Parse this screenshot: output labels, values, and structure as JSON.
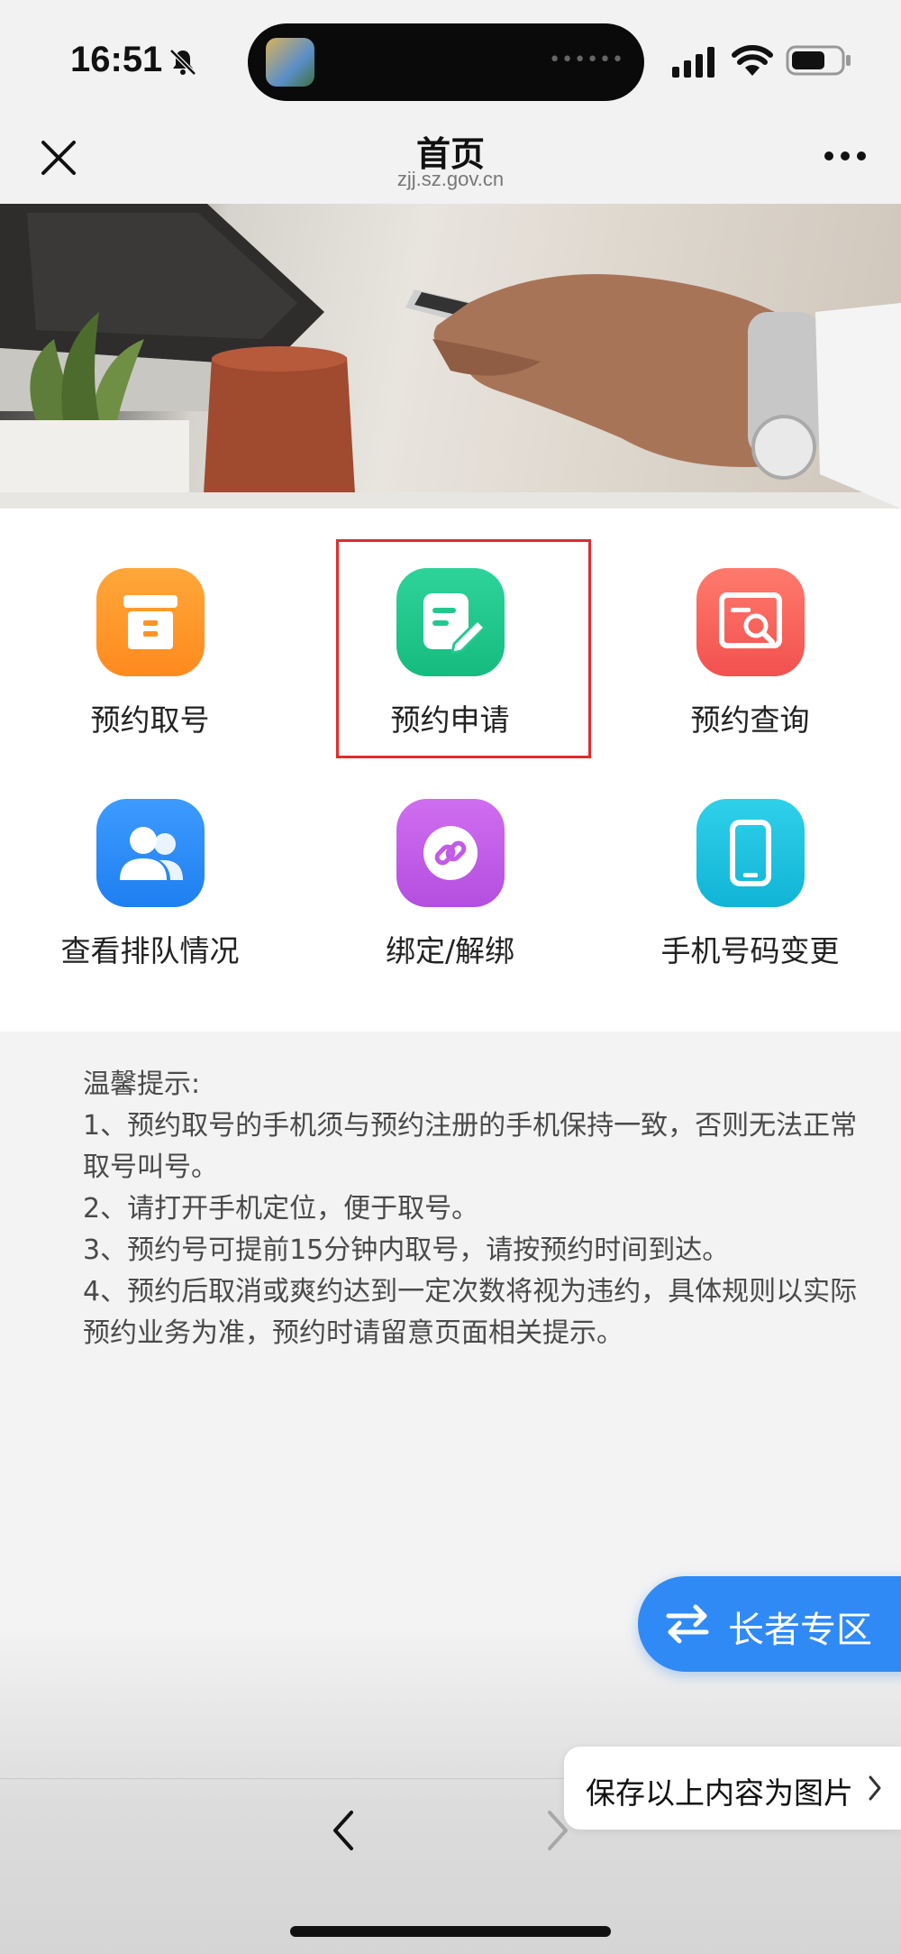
{
  "status_bar": {
    "time": "16:51",
    "icons": [
      "bell-off-icon",
      "signal-icon",
      "wifi-icon",
      "battery-icon"
    ]
  },
  "nav": {
    "title": "首页",
    "subtitle": "zjj.sz.gov.cn",
    "close_icon": "close-icon",
    "more_icon": "more-icon"
  },
  "grid": {
    "items": [
      {
        "label": "预约取号",
        "icon": "archive-icon",
        "color": "#ff9327"
      },
      {
        "label": "预约申请",
        "icon": "edit-document-icon",
        "color": "#22c98f"
      },
      {
        "label": "预约查询",
        "icon": "search-document-icon",
        "color": "#f7645e"
      },
      {
        "label": "查看排队情况",
        "icon": "users-icon",
        "color": "#2f8cf5"
      },
      {
        "label": "绑定/解绑",
        "icon": "link-icon",
        "color": "#c35ae8"
      },
      {
        "label": "手机号码变更",
        "icon": "phone-icon",
        "color": "#1dc2df"
      }
    ],
    "highlighted_item": "预约申请",
    "highlight_color": "#e02b2b"
  },
  "tips": {
    "title": "温馨提示:",
    "lines": [
      "1、预约取号的手机须与预约注册的手机保持一致，否则无法正常取号叫号。",
      "2、请打开手机定位，便于取号。",
      "3、预约号可提前15分钟内取号，请按预约时间到达。",
      "4、预约后取消或爽约达到一定次数将视为违约，具体规则以实际预约业务为准，预约时请留意页面相关提示。"
    ]
  },
  "elder_zone": {
    "label": "长者专区",
    "icon": "swap-icon",
    "color": "#2f8af5"
  },
  "save_button": {
    "label": "保存以上内容为图片"
  },
  "bottom_nav": {
    "back_icon": "back-icon",
    "forward_icon": "forward-icon"
  }
}
